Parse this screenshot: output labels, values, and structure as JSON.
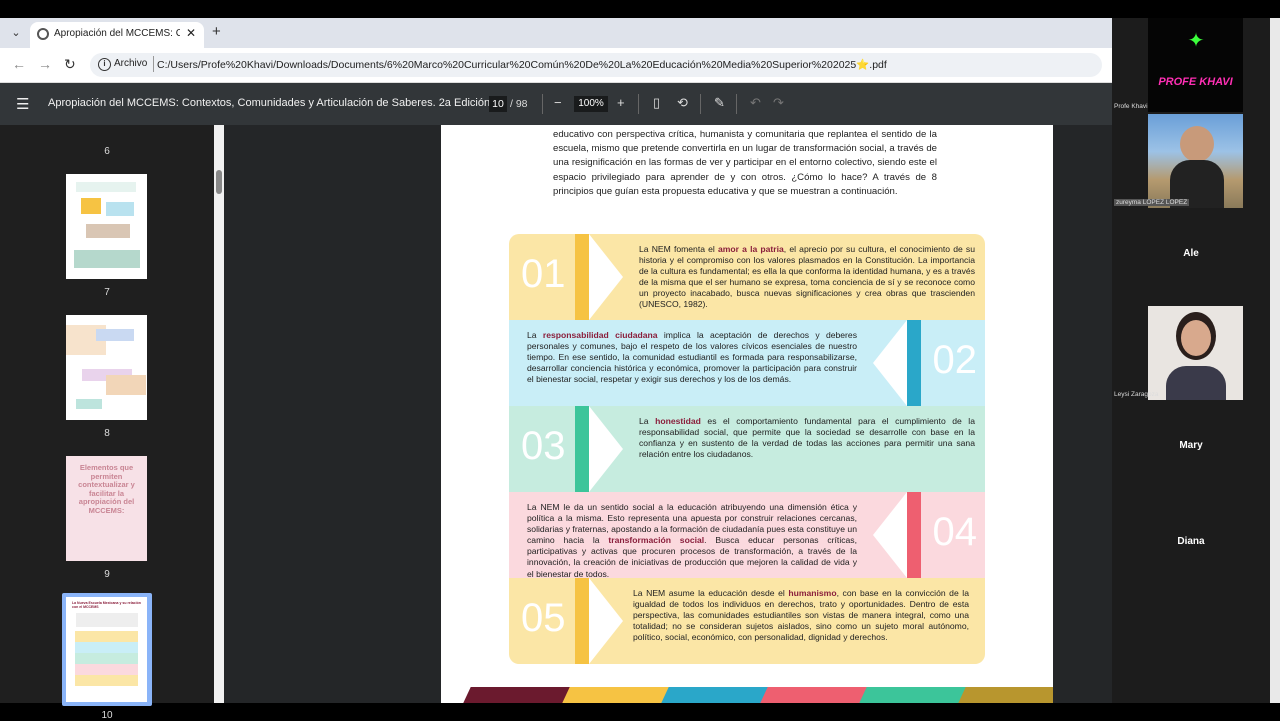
{
  "browser": {
    "tab_title": "Apropiación del MCCEMS: Cont",
    "omni_scheme": "Archivo",
    "url": "C:/Users/Profe%20Khavi/Downloads/Documents/6%20Marco%20Curricular%20Común%20De%20La%20Educación%20Media%20Superior%202025⭐.pdf"
  },
  "pdf": {
    "title": "Apropiación del MCCEMS: Contextos, Comunidades y Articulación de Saberes. 2a Edición.",
    "page_current": "10",
    "page_total": "/ 98",
    "zoom": "100%"
  },
  "thumbnails": [
    {
      "num": "6",
      "caption": ""
    },
    {
      "num": "7",
      "caption": ""
    },
    {
      "num": "8",
      "caption": ""
    },
    {
      "num": "9",
      "caption": "Elementos que permiten contextualizar y facilitar la apropiación del MCCEMS:"
    },
    {
      "num": "10",
      "caption": "La Nueva Escuela Mexicana y su relación con el MCCEMS"
    }
  ],
  "intro": "educativo con perspectiva crítica, humanista y comunitaria que replantea el sentido de la escuela, mismo que pretende convertirla en un lugar de transformación social, a través de una resignificación en las formas de ver y participar en el entorno colectivo, siendo este el espacio privilegiado para aprender de y con otros. ¿Cómo lo hace? A través de 8 principios que guían esta propuesta educativa y que se muestran a continuación.",
  "principles": [
    {
      "num": "01",
      "pre": "La NEM fomenta el ",
      "hl": "amor a la patria",
      "post": ", el aprecio por su cultura, el conocimiento de su historia y el compromiso con los valores plasmados en la Constitución. La importancia de la cultura es fundamental; es ella la que conforma la identidad humana, y es a través de la misma que el ser humano se expresa, toma conciencia de sí y se reconoce como un proyecto inacabado, busca nuevas significaciones y crea obras que trascienden (UNESCO, 1982).",
      "bg": "#fbe6a6",
      "accent": "#f6c343"
    },
    {
      "num": "02",
      "pre": "La ",
      "hl": "responsabilidad ciudadana",
      "post": " implica la aceptación de derechos y deberes personales y comunes, bajo el respeto de los valores cívicos esenciales de nuestro tiempo. En ese sentido, la comunidad estudiantil es formada para responsabilizarse, desarrollar conciencia histórica y económica, promover la participación para construir el bienestar social, respetar y exigir sus derechos y los de los demás.",
      "bg": "#c9eef7",
      "accent": "#2aa7c9"
    },
    {
      "num": "03",
      "pre": "La ",
      "hl": "honestidad",
      "post": " es el comportamiento fundamental para el cumplimiento de la responsabilidad social, que permite que la sociedad se desarrolle con base en la confianza y en sustento de la verdad de todas las acciones para permitir una sana relación entre los ciudadanos.",
      "bg": "#c6ecdf",
      "accent": "#3cc59a"
    },
    {
      "num": "04",
      "pre": "La NEM le da un sentido social a la educación atribuyendo una dimensión ética y política a la misma. Esto representa una apuesta por construir relaciones cercanas, solidarias y fraternas, apostando a la formación de ciudadanía pues esta constituye un camino hacia la ",
      "hl": "transformación social",
      "post": ". Busca educar personas críticas, participativas y activas que procuren procesos de transformación, a través de la innovación, la creación de iniciativas de producción que mejoren la calidad de vida y el bienestar de todos.",
      "bg": "#fbd9de",
      "accent": "#ee5f70"
    },
    {
      "num": "05",
      "pre": "La NEM asume la educación desde el ",
      "hl": "humanismo",
      "post": ", con base en la convicción de la igualdad de todos los individuos en derechos, trato y oportunidades. Dentro de esta perspectiva, las comunidades estudiantiles son vistas de manera integral, como una totalidad; no se consideran sujetos aislados, sino como un sujeto moral autónomo, político, social, económico, con personalidad, dignidad y derechos.",
      "bg": "#fbe6a6",
      "accent": "#f6c343"
    }
  ],
  "participants": [
    {
      "name": "Profe Khavi",
      "label": "PROFE KHAVI",
      "type": "logo"
    },
    {
      "name": "zureyma LOPEZ LOPEZ",
      "type": "video"
    },
    {
      "name": "Ale",
      "type": "name"
    },
    {
      "name": "Leysi Zaragoza",
      "type": "video"
    },
    {
      "name": "Mary",
      "type": "name"
    },
    {
      "name": "Diana",
      "type": "name"
    }
  ],
  "colors": {
    "patria": "#8a1f3c",
    "footer": [
      "#6b1a2e",
      "#f6c343",
      "#2aa7c9",
      "#ee5f70",
      "#3cc59a",
      "#b8962e"
    ]
  }
}
